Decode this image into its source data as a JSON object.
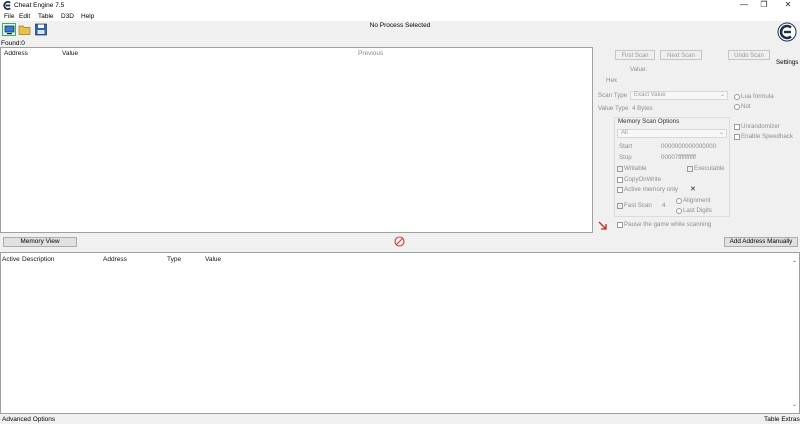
{
  "window": {
    "title": "Cheat Engine 7.5",
    "minimize": "—",
    "maximize": "❐",
    "close": "✕"
  },
  "menu": [
    "File",
    "Edit",
    "Table",
    "D3D",
    "Help"
  ],
  "toolbar": {
    "process_label": "No Process Selected",
    "settings_label": "Settings"
  },
  "found_label": "Found:0",
  "results_table": {
    "columns": [
      "Address",
      "Value",
      "Previous"
    ]
  },
  "scan_panel": {
    "first_scan": "First Scan",
    "next_scan": "Next Scan",
    "undo_scan": "Undo Scan",
    "value_label": "Value:",
    "hex_label": "Hex",
    "scan_type_label": "Scan Type",
    "scan_type_value": "Exact Value",
    "value_type_label": "Value Type",
    "value_type_value": "4 Bytes",
    "memory_scan_options": "Memory Scan Options",
    "memory_region": "All",
    "start_label": "Start",
    "start_value": "0000000000000000",
    "stop_label": "Stop",
    "stop_value": "00007fffffffffff",
    "writable": "Writable",
    "executable": "Executable",
    "copy_on_write": "CopyOnWrite",
    "active_memory_only": "Active memory only",
    "fast_scan": "Fast Scan",
    "fast_scan_value": "4",
    "alignment": "Alignment",
    "last_digits": "Last Digits",
    "pause_game": "Pause the game while scanning",
    "lua_formula": "Lua formula",
    "not_label": "Not",
    "unrandomizer": "Unrandomizer",
    "enable_speedhack": "Enable Speedhack",
    "close_x": "✕"
  },
  "bottom": {
    "memory_view": "Memory View",
    "add_address": "Add Address Manually"
  },
  "address_table": {
    "columns": [
      "Active",
      "Description",
      "Address",
      "Type",
      "Value"
    ]
  },
  "statusbar": {
    "left": "Advanced Options",
    "right": "Table Extras"
  },
  "colors": {
    "accent_teal": "#0aa4a0",
    "logo_dark": "#1c2f4d",
    "stop_red": "#d93b3b"
  }
}
